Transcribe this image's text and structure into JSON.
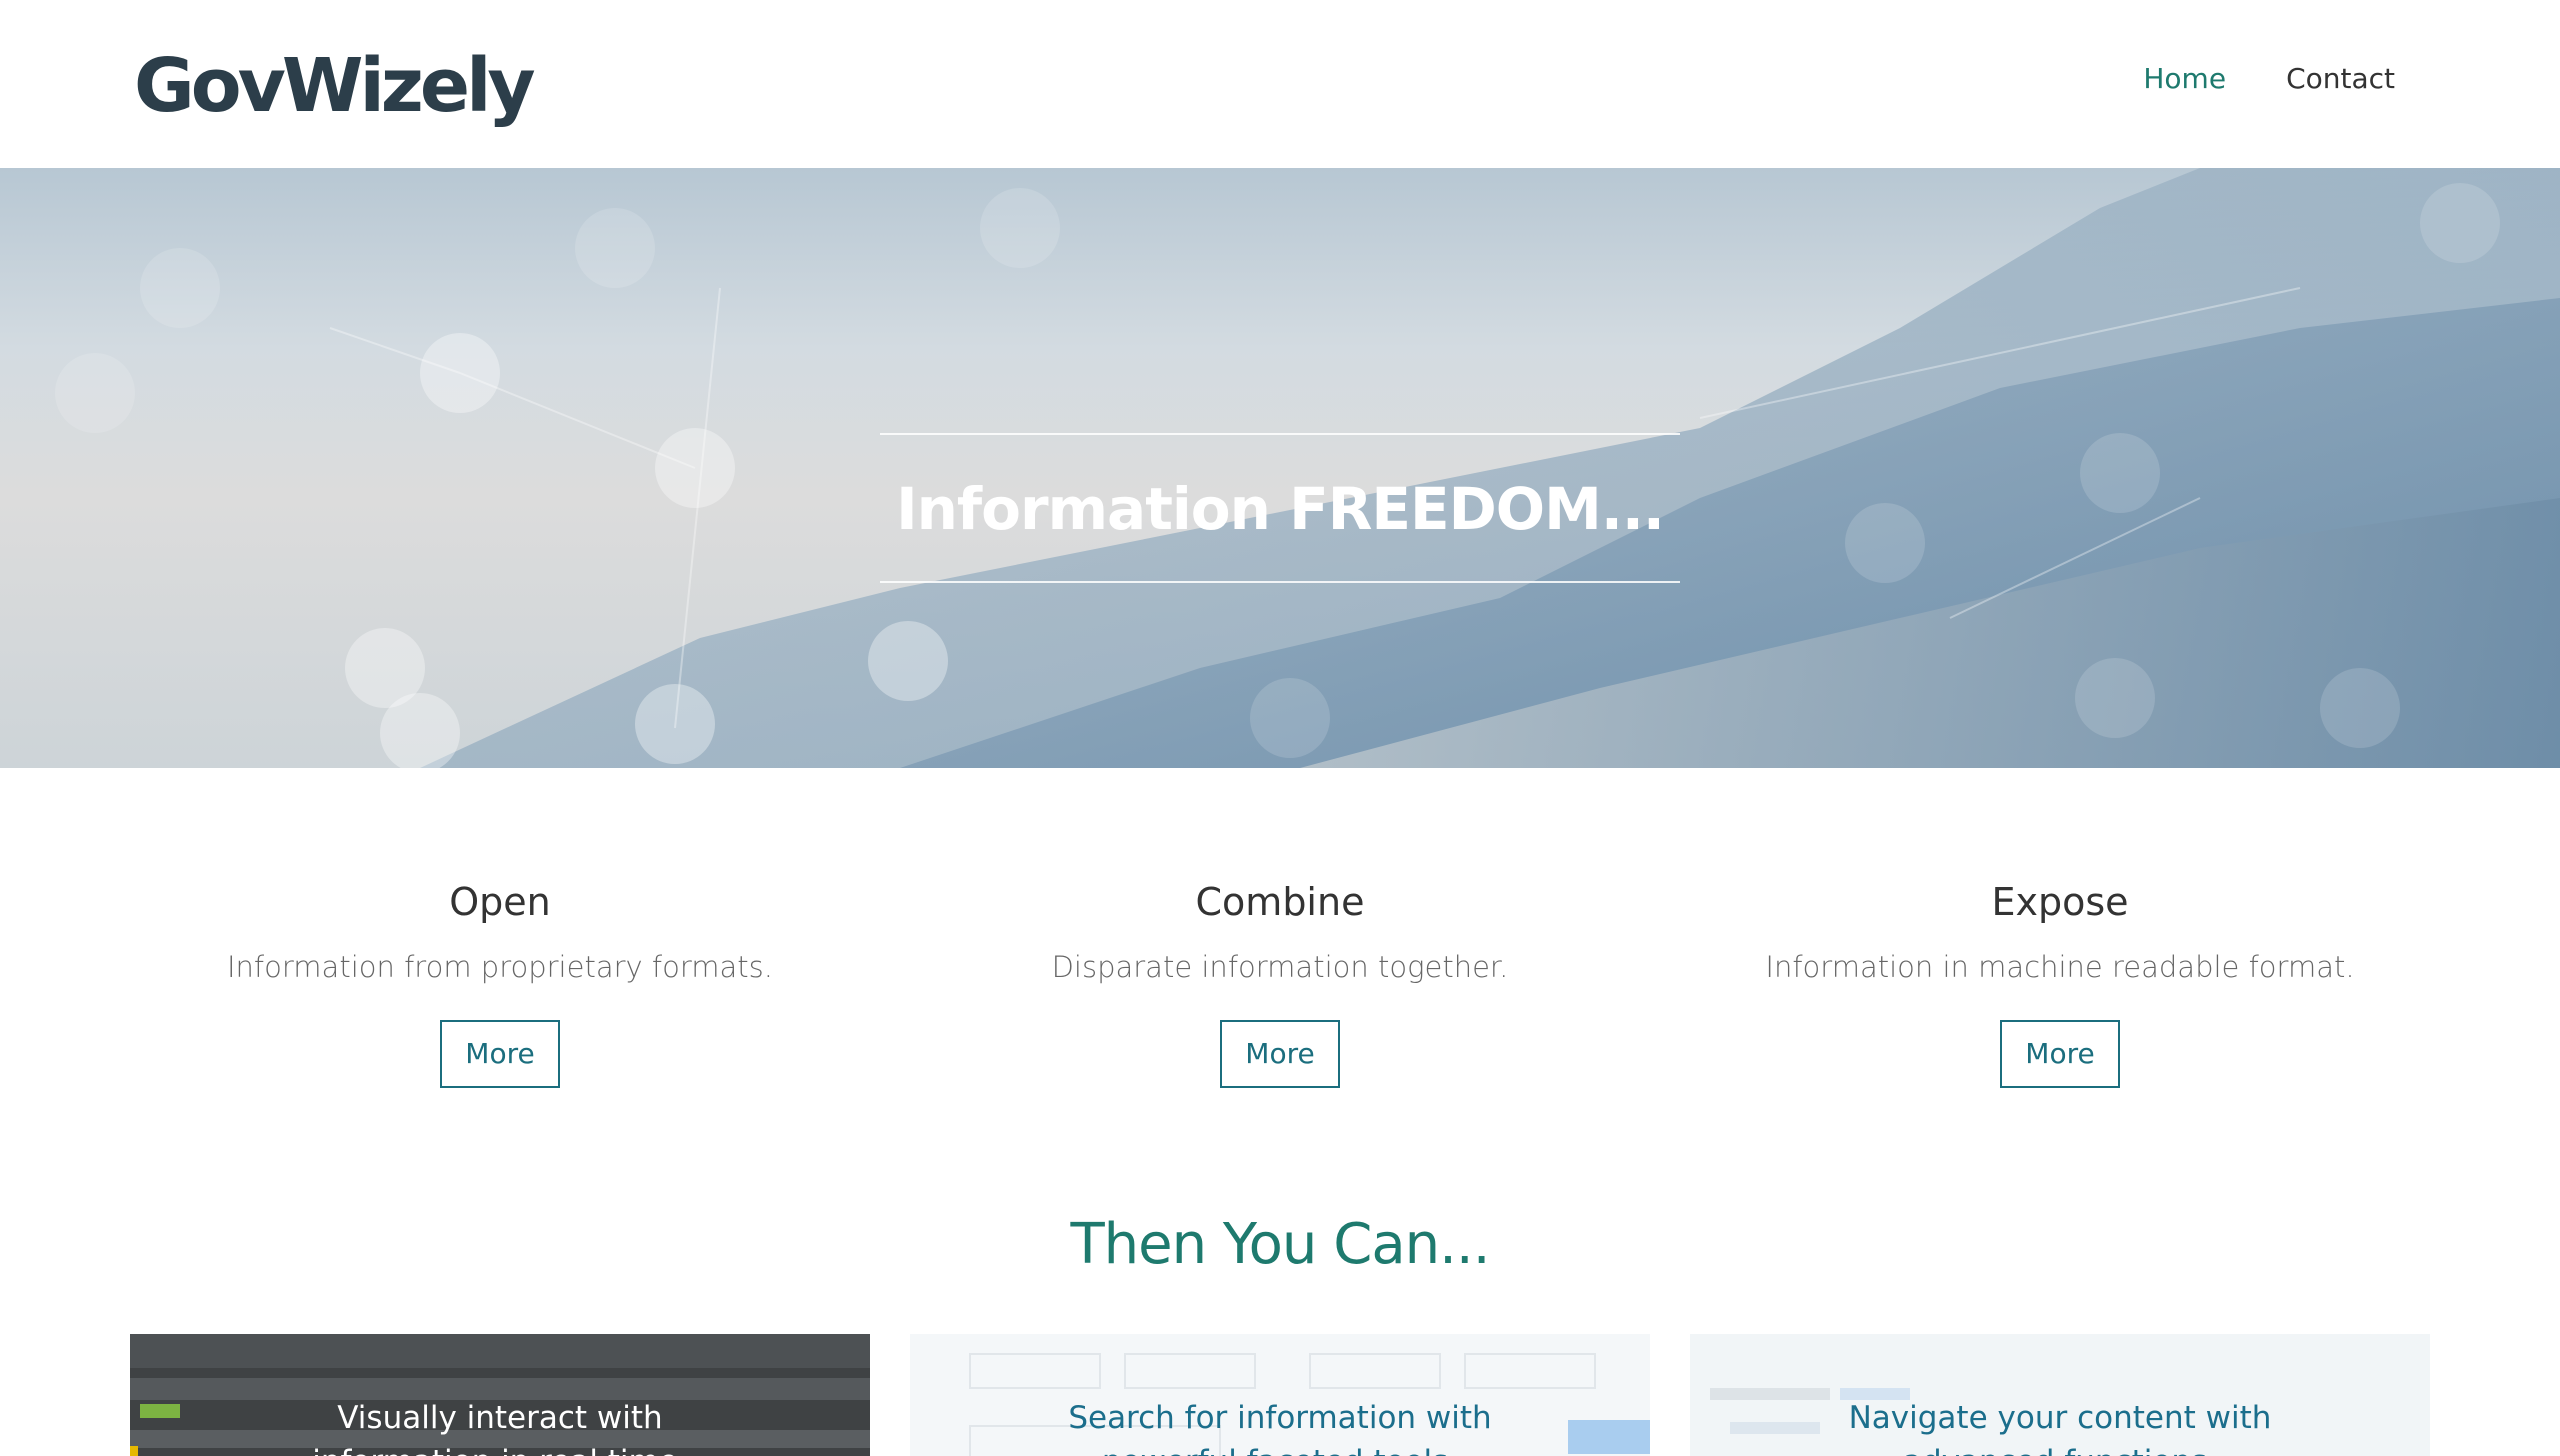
{
  "header": {
    "logo_text": "GovWizely",
    "nav": [
      {
        "label": "Home",
        "active": true
      },
      {
        "label": "Contact",
        "active": false
      }
    ]
  },
  "hero": {
    "title": "Information FREEDOM..."
  },
  "features": [
    {
      "title": "Open",
      "description": "Information from proprietary formats.",
      "button": "More"
    },
    {
      "title": "Combine",
      "description": "Disparate information together.",
      "button": "More"
    },
    {
      "title": "Expose",
      "description": "Information in machine readable format.",
      "button": "More"
    }
  ],
  "section": {
    "title": "Then You Can..."
  },
  "cards": [
    {
      "line1": "Visually interact with",
      "line2": "information in real time."
    },
    {
      "line1": "Search for information with",
      "line2": "powerful faceted tools."
    },
    {
      "line1": "Navigate your content with",
      "line2": "advanced functions."
    }
  ],
  "colors": {
    "accent": "#1e7a6e",
    "button_border": "#1b6e7e",
    "logo": "#2c3e4a"
  }
}
